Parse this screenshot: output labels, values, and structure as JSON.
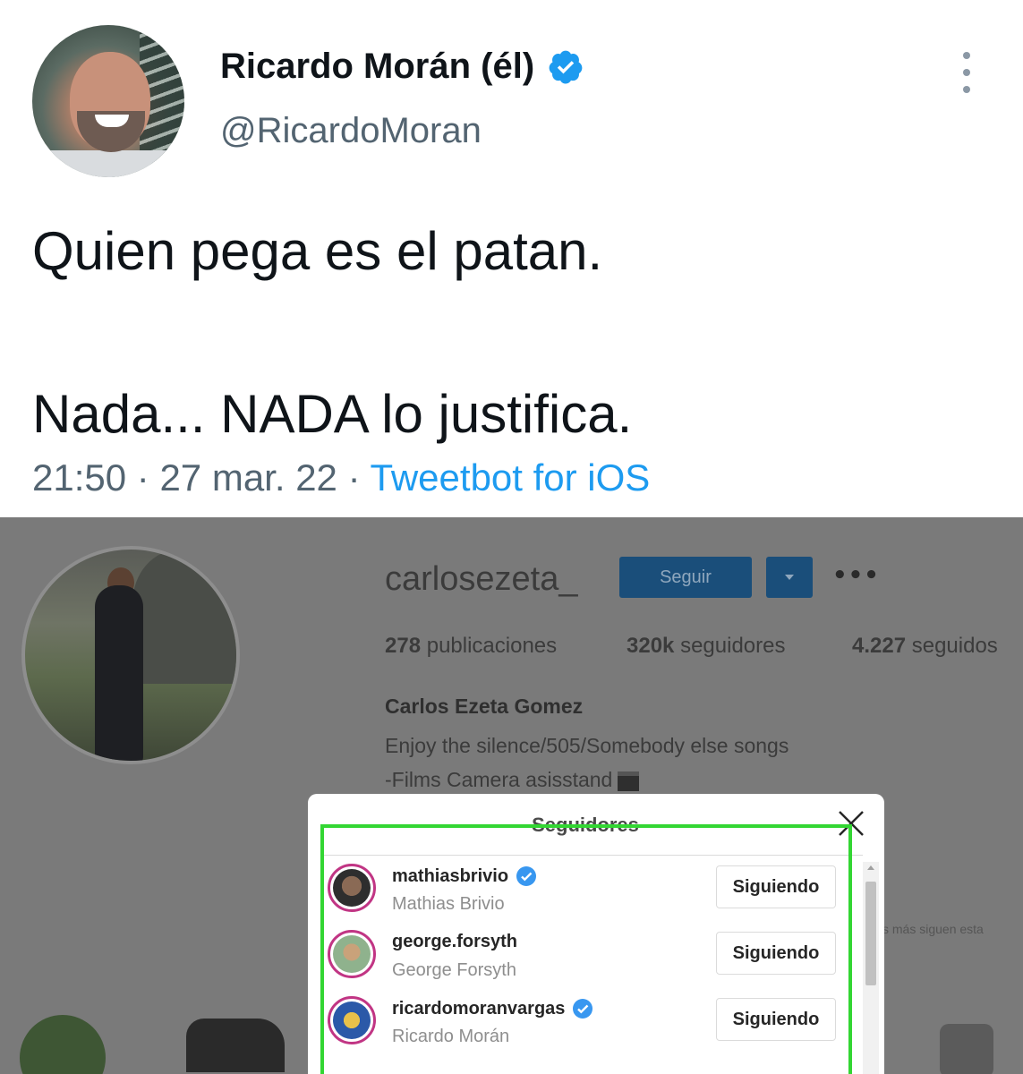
{
  "tweet": {
    "display_name": "Ricardo Morán (él)",
    "handle": "@RicardoMoran",
    "verified": true,
    "text_line1": "Quien pega es el patan.",
    "text_line2": "Nada... NADA lo justifica.",
    "time": "21:50",
    "date": "27 mar. 22",
    "separator": "·",
    "source": "Tweetbot for iOS",
    "accent_color": "#1d9bf0"
  },
  "instagram": {
    "username": "carlosezeta_",
    "follow_label": "Seguir",
    "options_label": "•••",
    "stats": {
      "posts_count": "278",
      "posts_label": "publicaciones",
      "followers_count": "320k",
      "followers_label": "seguidores",
      "following_count": "4.227",
      "following_label": "seguidos"
    },
    "full_name": "Carlos Ezeta Gomez",
    "bio_line1": "Enjoy the silence/505/Somebody else songs",
    "bio_line2": "-Films Camera asisstand",
    "side_text": "s más siguen esta",
    "modal": {
      "title": "Seguidores",
      "followers": [
        {
          "username": "mathiasbrivio",
          "name": "Mathias Brivio",
          "verified": true,
          "button": "Siguiendo"
        },
        {
          "username": "george.forsyth",
          "name": "George Forsyth",
          "verified": false,
          "button": "Siguiendo"
        },
        {
          "username": "ricardomoranvargas",
          "name": "Ricardo Morán",
          "verified": true,
          "button": "Siguiendo"
        }
      ]
    }
  }
}
